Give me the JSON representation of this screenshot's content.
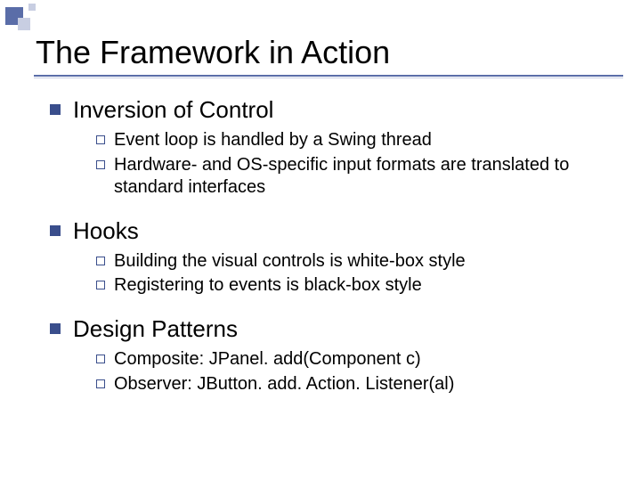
{
  "title": "The Framework in Action",
  "sections": [
    {
      "heading": "Inversion of Control",
      "items": [
        "Event loop is handled by a Swing thread",
        "Hardware- and OS-specific input formats are translated to standard interfaces"
      ]
    },
    {
      "heading": "Hooks",
      "items": [
        "Building the visual controls is white-box style",
        "Registering to events is black-box style"
      ]
    },
    {
      "heading": "Design Patterns",
      "items": [
        "Composite: JPanel. add(Component c)",
        "Observer: JButton. add. Action. Listener(al)"
      ]
    }
  ]
}
